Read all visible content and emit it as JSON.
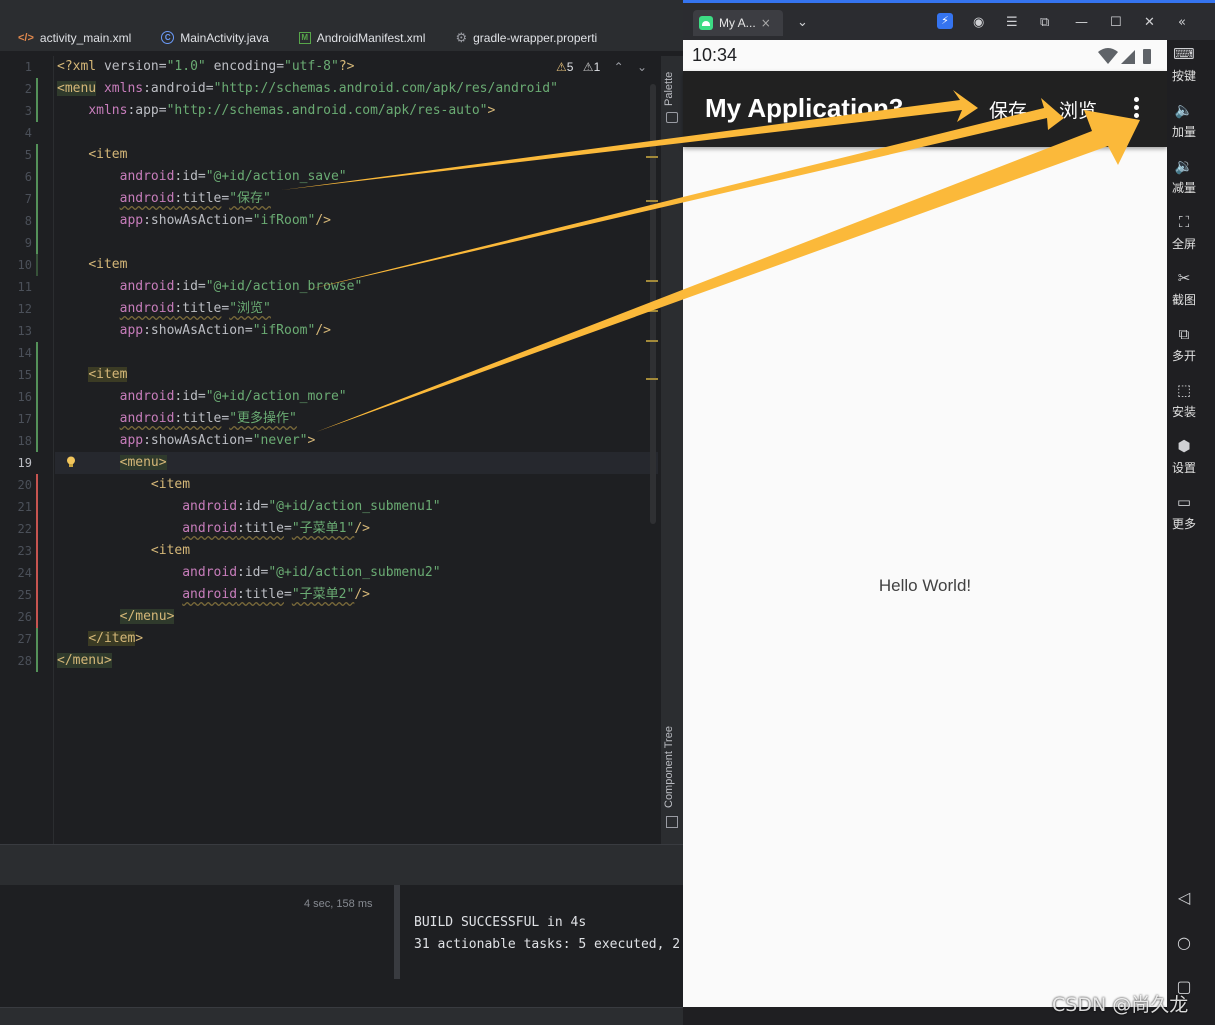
{
  "ide": {
    "tabs": [
      {
        "icon": "</>",
        "label": "activity_main.xml"
      },
      {
        "icon": "C",
        "label": "MainActivity.java"
      },
      {
        "icon": "M",
        "label": "AndroidManifest.xml"
      },
      {
        "icon": "⚙",
        "label": "gradle-wrapper.properti"
      }
    ],
    "inspections": {
      "warnings": "5",
      "weak_warnings": "1"
    },
    "code_lines": [
      "<?xml version=\"1.0\" encoding=\"utf-8\"?>",
      "<menu xmlns:android=\"http://schemas.android.com/apk/res/android\"",
      "    xmlns:app=\"http://schemas.android.com/apk/res-auto\">",
      "",
      "    <item",
      "        android:id=\"@+id/action_save\"",
      "        android:title=\"保存\"",
      "        app:showAsAction=\"ifRoom\"/>",
      "",
      "    <item",
      "        android:id=\"@+id/action_browse\"",
      "        android:title=\"浏览\"",
      "        app:showAsAction=\"ifRoom\"/>",
      "",
      "    <item",
      "        android:id=\"@+id/action_more\"",
      "        android:title=\"更多操作\"",
      "        app:showAsAction=\"never\">",
      "        <menu>",
      "            <item",
      "                android:id=\"@+id/action_submenu1\"",
      "                android:title=\"子菜单1\"/>",
      "            <item",
      "                android:id=\"@+id/action_submenu2\"",
      "                android:title=\"子菜单2\"/>",
      "        </menu>",
      "    </item>",
      "</menu>"
    ],
    "current_line": 19,
    "side_panels": {
      "palette": "Palette",
      "component_tree": "Component Tree"
    },
    "build": {
      "duration": "4 sec, 158 ms",
      "lines": [
        "BUILD SUCCESSFUL in 4s",
        "31 actionable tasks: 5 executed, 2"
      ]
    }
  },
  "emulator": {
    "window_title": "My A...",
    "close_glyph": "×",
    "status_time": "10:34",
    "app_title": "My Application3",
    "actions": {
      "save": "保存",
      "browse": "浏览"
    },
    "hello_text": "Hello World!",
    "toolbar": [
      {
        "icon": "keyboard-icon",
        "label": "按键"
      },
      {
        "icon": "volume-up-icon",
        "label": "加量"
      },
      {
        "icon": "volume-down-icon",
        "label": "减量"
      },
      {
        "icon": "fullscreen-icon",
        "label": "全屏"
      },
      {
        "icon": "scissors-icon",
        "label": "截图"
      },
      {
        "icon": "multi-window-icon",
        "label": "多开"
      },
      {
        "icon": "apk-icon",
        "label": "安装"
      },
      {
        "icon": "settings-icon",
        "label": "设置"
      },
      {
        "icon": "more-icon",
        "label": "更多"
      }
    ]
  },
  "watermark": "CSDN @尚久龙",
  "colors": {
    "arrow": "#fbb93a",
    "ide_bg": "#1e1f22",
    "appbar": "#212121",
    "accent": "#3574f0"
  }
}
